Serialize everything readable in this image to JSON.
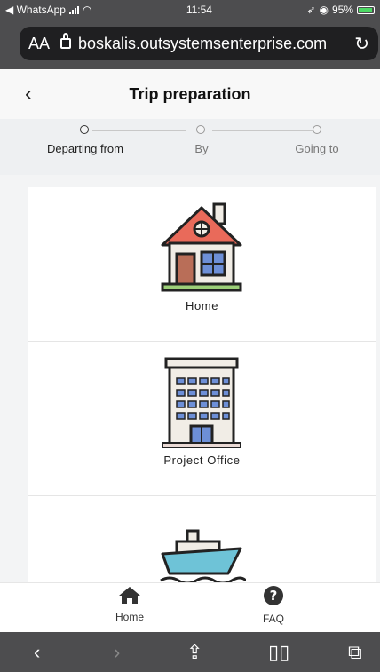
{
  "status_bar": {
    "back_app": "◀ WhatsApp",
    "time": "11:54",
    "battery": "95%"
  },
  "browser": {
    "aa": "AA",
    "url": "boskalis.outsystemsenterprise.com"
  },
  "header": {
    "title": "Trip preparation"
  },
  "stepper": {
    "steps": [
      "Departing from",
      "By",
      "Going to"
    ],
    "active_index": 0
  },
  "options": [
    {
      "label": "Home",
      "icon": "house-icon"
    },
    {
      "label": "Project Office",
      "icon": "office-building-icon"
    },
    {
      "label": "",
      "icon": "ship-icon"
    }
  ],
  "bottom_nav": {
    "items": [
      {
        "label": "Home",
        "icon": "home-icon"
      },
      {
        "label": "FAQ",
        "icon": "question-icon"
      }
    ]
  },
  "colors": {
    "roof": "#e96a5a",
    "door": "#b96e58",
    "window": "#6d8fd7",
    "grass": "#9ccf78",
    "ship_hull": "#6ec3d7"
  }
}
